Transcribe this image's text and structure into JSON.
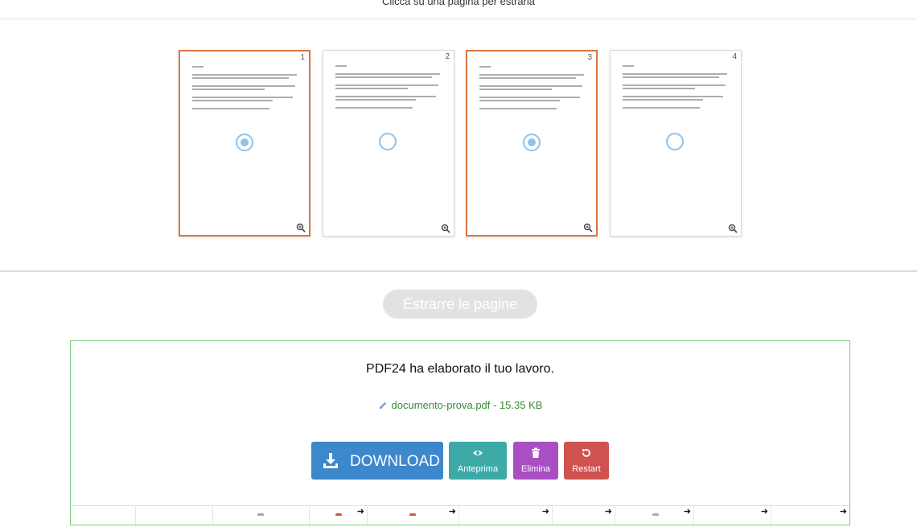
{
  "header": {
    "hint": "Clicca su una pagina per estrarla"
  },
  "pages": [
    {
      "number": "1",
      "selected": true
    },
    {
      "number": "2",
      "selected": false
    },
    {
      "number": "3",
      "selected": true
    },
    {
      "number": "4",
      "selected": false
    }
  ],
  "extract_button": {
    "label": "Estrarre le pagine"
  },
  "result": {
    "title": "PDF24 ha elaborato il tuo lavoro.",
    "file": "documento-prova.pdf - 15.35 KB",
    "buttons": {
      "download": "DOWNLOAD",
      "preview": "Anteprima",
      "delete": "Elimina",
      "restart": "Restart"
    }
  },
  "colors": {
    "selected_border": "#d9773f",
    "radio": "#8ec3ea",
    "download": "#3d87cc",
    "preview": "#3daaa8",
    "delete": "#a94fc3",
    "restart": "#d0524f",
    "result_border": "#7fcf7f"
  }
}
